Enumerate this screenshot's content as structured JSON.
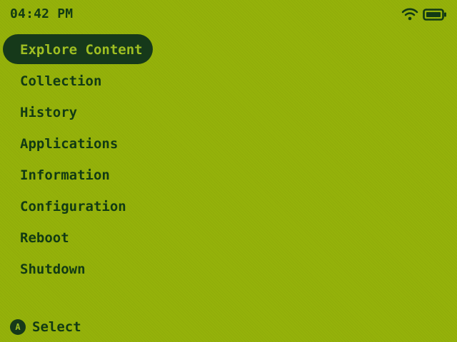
{
  "status_bar": {
    "time": "04:42 PM",
    "wifi_icon": "wifi-icon",
    "battery_icon": "battery-icon"
  },
  "menu": {
    "selected_index": 0,
    "items": [
      {
        "label": "Explore Content"
      },
      {
        "label": "Collection"
      },
      {
        "label": "History"
      },
      {
        "label": "Applications"
      },
      {
        "label": "Information"
      },
      {
        "label": "Configuration"
      },
      {
        "label": "Reboot"
      },
      {
        "label": "Shutdown"
      }
    ]
  },
  "footer": {
    "button_glyph": "A",
    "action_label": "Select"
  },
  "colors": {
    "background": "#95b20a",
    "foreground": "#123a14",
    "highlight": "#16391a",
    "highlight_text": "#9fbf22"
  }
}
